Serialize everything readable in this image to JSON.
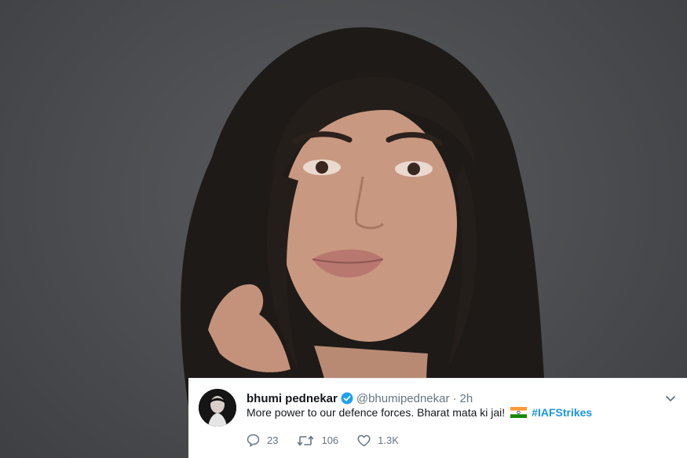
{
  "tweet": {
    "display_name": "bhumi pednekar",
    "handle": "@bhumipednekar",
    "separator": "·",
    "time": "2h",
    "text": "More power to our defence forces. Bharat mata ki jai!",
    "hashtag": "#IAFStrikes",
    "replies": "23",
    "retweets": "106",
    "likes": "1.3K"
  },
  "icons": [
    "verified-badge-icon",
    "reply-icon",
    "retweet-icon",
    "like-icon",
    "chevron-down-icon",
    "india-flag-icon"
  ],
  "colors": {
    "background": "#4a4b4e",
    "tweet_card": "#ffffff",
    "text": "#14171a",
    "secondary_text": "#657786",
    "link": "#1b95e0",
    "verified": "#1da1f2"
  }
}
